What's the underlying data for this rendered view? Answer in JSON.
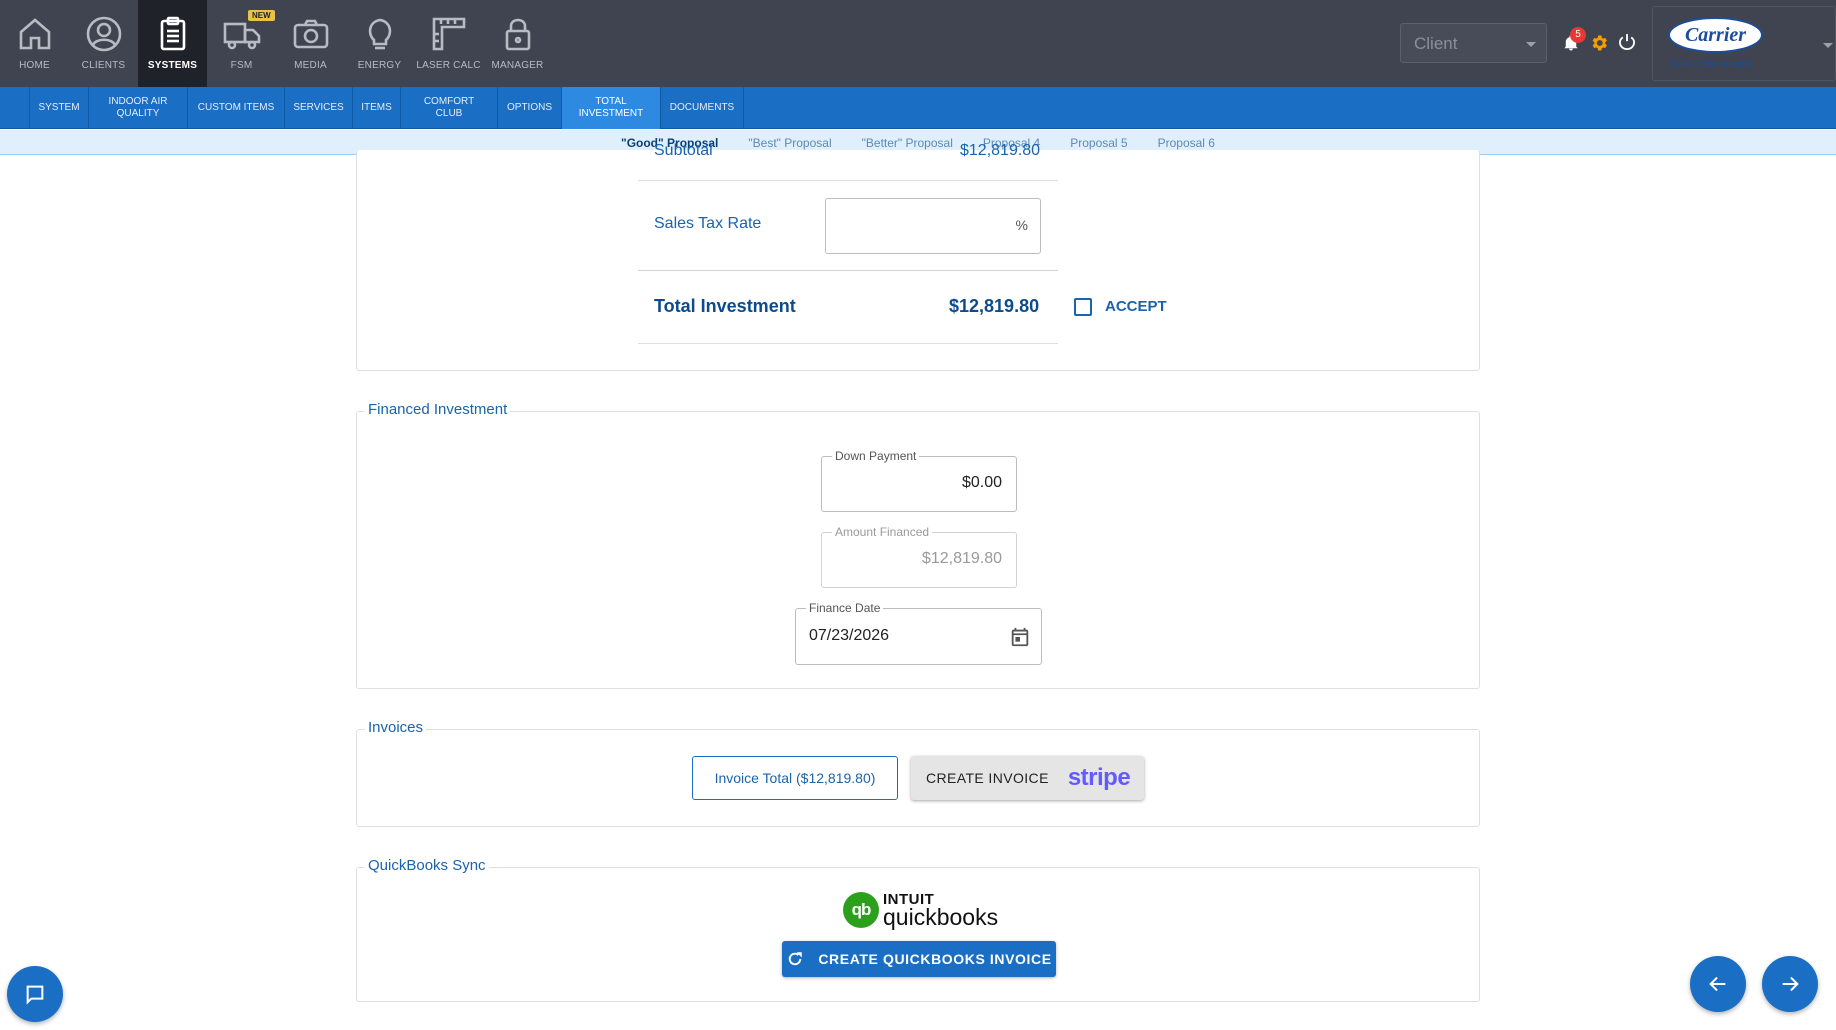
{
  "nav": {
    "items": [
      {
        "label": "HOME",
        "icon": "home-icon"
      },
      {
        "label": "CLIENTS",
        "icon": "user-circle-icon"
      },
      {
        "label": "SYSTEMS",
        "icon": "clipboard-icon"
      },
      {
        "label": "FSM",
        "icon": "truck-icon",
        "badge": "NEW"
      },
      {
        "label": "MEDIA",
        "icon": "camera-icon"
      },
      {
        "label": "ENERGY",
        "icon": "lightbulb-icon"
      },
      {
        "label": "LASER CALC",
        "icon": "ruler-icon"
      },
      {
        "label": "MANAGER",
        "icon": "lock-icon"
      }
    ],
    "active": "SYSTEMS"
  },
  "header": {
    "client_placeholder": "Client",
    "notification_count": "5",
    "brand_name": "Carrier",
    "brand_tagline": "Turn to the experts"
  },
  "tabs": {
    "items": [
      "SYSTEM",
      "INDOOR AIR QUALITY",
      "CUSTOM ITEMS",
      "SERVICES",
      "ITEMS",
      "COMFORT CLUB",
      "OPTIONS",
      "TOTAL INVESTMENT",
      "DOCUMENTS"
    ],
    "active": "TOTAL INVESTMENT"
  },
  "proposals": {
    "items": [
      "\"Good\" Proposal",
      "\"Best\" Proposal",
      "\"Better\" Proposal",
      "Proposal 4",
      "Proposal 5",
      "Proposal 6"
    ],
    "active": "\"Good\" Proposal"
  },
  "summary": {
    "subtotal_label": "Subtotal",
    "subtotal_value": "$12,819.80",
    "tax_label": "Sales Tax Rate",
    "tax_suffix": "%",
    "total_label": "Total Investment",
    "total_value": "$12,819.80",
    "accept_label": "ACCEPT"
  },
  "financed": {
    "legend": "Financed Investment",
    "down_payment_label": "Down Payment",
    "down_payment_value": "$0.00",
    "amount_financed_label": "Amount Financed",
    "amount_financed_value": "$12,819.80",
    "finance_date_label": "Finance Date",
    "finance_date_value": "07/23/2026"
  },
  "invoices": {
    "legend": "Invoices",
    "invoice_total_button": "Invoice Total ($12,819.80)",
    "create_invoice_button": "CREATE INVOICE",
    "stripe_logo": "stripe"
  },
  "quickbooks": {
    "legend": "QuickBooks Sync",
    "logo_top": "INTUIT",
    "logo_bottom": "quickbooks",
    "create_button": "CREATE QUICKBOOKS INVOICE"
  },
  "colors": {
    "topbar": "#3f4450",
    "tabbar": "#1a6ec4",
    "accent": "#1a63ad",
    "stripe": "#635bff",
    "quickbooks": "#2ca01c"
  }
}
